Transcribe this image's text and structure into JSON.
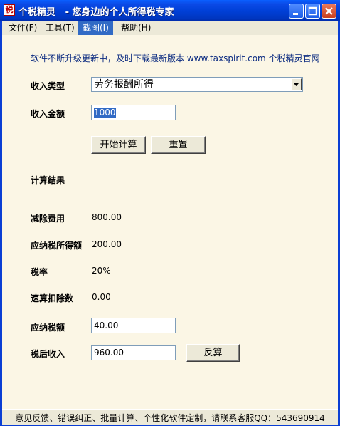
{
  "window": {
    "icon_glyph": "税",
    "title": "个税精灵   - 您身边的个人所得税专家"
  },
  "menu": {
    "items": [
      "文件(F)",
      "工具(T)",
      "截图(I)",
      "帮助(H)"
    ]
  },
  "banner": "软件不断升级更新中，及时下载最新版本 www.taxspirit.com 个税精灵官网",
  "form": {
    "income_type_label": "收入类型",
    "income_type_value": "劳务报酬所得",
    "income_amount_label": "收入金额",
    "income_amount_value": "1000",
    "calc_button": "开始计算",
    "reset_button": "重置"
  },
  "results": {
    "heading": "计算结果",
    "deduction_label": "减除费用",
    "deduction_value": "800.00",
    "taxable_income_label": "应纳税所得额",
    "taxable_income_value": "200.00",
    "tax_rate_label": "税率",
    "tax_rate_value": "20%",
    "quick_deduction_label": "速算扣除数",
    "quick_deduction_value": "0.00",
    "tax_payable_label": "应纳税额",
    "tax_payable_value": "40.00",
    "after_tax_label": "税后收入",
    "after_tax_value": "960.00",
    "reverse_button": "反算"
  },
  "status": "意见反馈、错误纠正、批量计算、个性化软件定制，请联系客服QQ：543690914",
  "colors": {
    "titlebar": "#0040d8",
    "menu_active": "#316ac5",
    "client_bg": "#fbf6e5",
    "banner_text": "#0a2a80"
  }
}
